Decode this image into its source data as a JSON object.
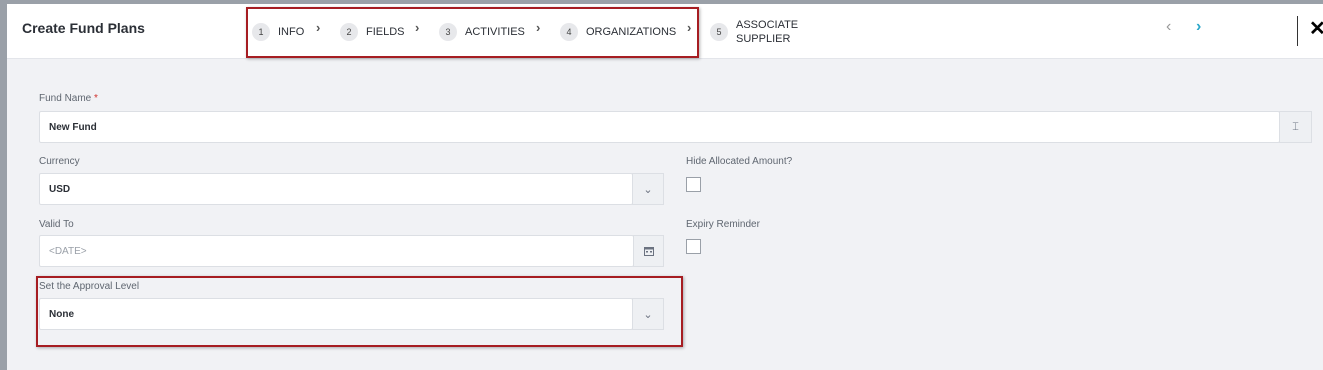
{
  "header": {
    "title": "Create Fund Plans",
    "steps": [
      {
        "num": "1",
        "label": "INFO"
      },
      {
        "num": "2",
        "label": "FIELDS"
      },
      {
        "num": "3",
        "label": "ACTIVITIES"
      },
      {
        "num": "4",
        "label": "ORGANIZATIONS"
      },
      {
        "num": "5",
        "label_line1": "ASSOCIATE",
        "label_line2": "SUPPLIER"
      }
    ],
    "prev_icon": "‹",
    "next_icon": "›",
    "close_icon": "✕"
  },
  "form": {
    "fund_name": {
      "label": "Fund Name",
      "required_mark": "*",
      "value": "New Fund"
    },
    "currency": {
      "label": "Currency",
      "value": "USD"
    },
    "hide_allocated": {
      "label": "Hide Allocated Amount?"
    },
    "valid_to": {
      "label": "Valid To",
      "placeholder": "<DATE>"
    },
    "expiry_reminder": {
      "label": "Expiry Reminder"
    },
    "approval_level": {
      "label": "Set the Approval Level",
      "value": "None"
    }
  },
  "colors": {
    "highlight": "#a61d22",
    "accent": "#2aa7c9"
  }
}
